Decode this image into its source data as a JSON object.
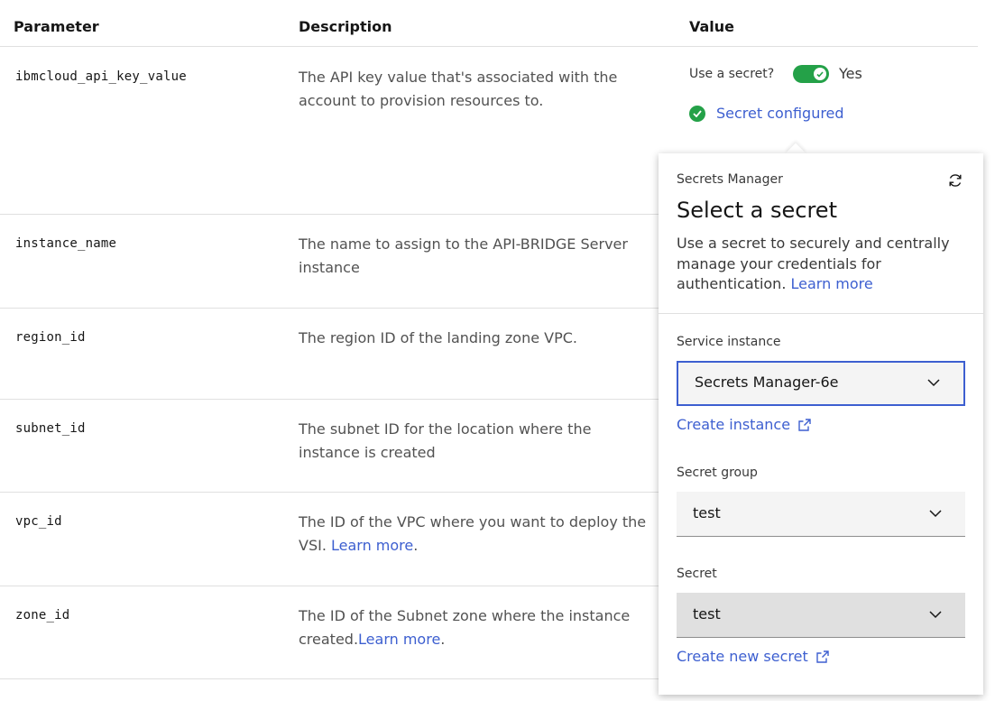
{
  "table": {
    "headers": {
      "parameter": "Parameter",
      "description": "Description",
      "value": "Value"
    },
    "rows": [
      {
        "param": "ibmcloud_api_key_value",
        "desc": "The API key value that's associated with the account to provision resources to."
      },
      {
        "param": "instance_name",
        "desc": "The name to assign to the API-BRIDGE Server instance"
      },
      {
        "param": "region_id",
        "desc": "The region ID of the landing zone VPC."
      },
      {
        "param": "subnet_id",
        "desc": "The subnet ID for the location where the instance is created"
      },
      {
        "param": "vpc_id",
        "desc": "The ID of the VPC where you want to deploy the VSI.",
        "link": "Learn more",
        "after": "."
      },
      {
        "param": "zone_id",
        "desc": "The ID of the Subnet zone where the instance created.",
        "link": "Learn more",
        "after": "."
      }
    ]
  },
  "api_key_value": {
    "use_secret_label": "Use a secret?",
    "toggle_on": true,
    "toggle_label": "Yes",
    "status": "Secret configured"
  },
  "popover": {
    "supertitle": "Secrets Manager",
    "title": "Select a secret",
    "body": "Use a secret to securely and centrally manage your credentials for authentication.",
    "body_link": "Learn more",
    "service_instance": {
      "label": "Service instance",
      "value": "Secrets Manager-6e"
    },
    "create_instance": "Create instance",
    "secret_group": {
      "label": "Secret group",
      "value": "test"
    },
    "secret": {
      "label": "Secret",
      "value": "test"
    },
    "create_secret": "Create new secret"
  },
  "colors": {
    "link": "#3d5fd0",
    "success": "#24a148",
    "border": "#e0e0e0"
  },
  "icons": {
    "refresh": "refresh-icon",
    "check": "checkmark-filled-icon",
    "chevron": "chevron-down-icon",
    "external": "launch-icon"
  }
}
